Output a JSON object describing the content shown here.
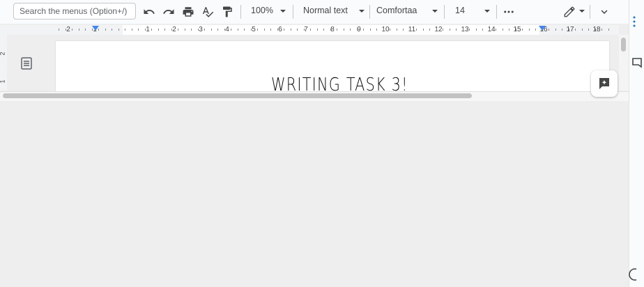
{
  "toolbar": {
    "search_placeholder": "Search the menus (Option+/)",
    "zoom": "100%",
    "style": "Normal text",
    "font": "Comfortaa",
    "font_size": "14"
  },
  "ruler": {
    "labels": [
      "2",
      "1",
      "1",
      "2",
      "3",
      "4",
      "5",
      "6",
      "7",
      "8",
      "9",
      "10",
      "11",
      "12",
      "13",
      "14",
      "15",
      "16",
      "17",
      "18"
    ]
  },
  "vertical_ruler": {
    "labels": [
      "2",
      "1"
    ]
  },
  "document": {
    "title": "WRITING TASK 3!"
  },
  "colors": {
    "accent": "#4285f4",
    "toolbar_bg": "#f9fbfd",
    "canvas_bg": "#eeeeee"
  }
}
